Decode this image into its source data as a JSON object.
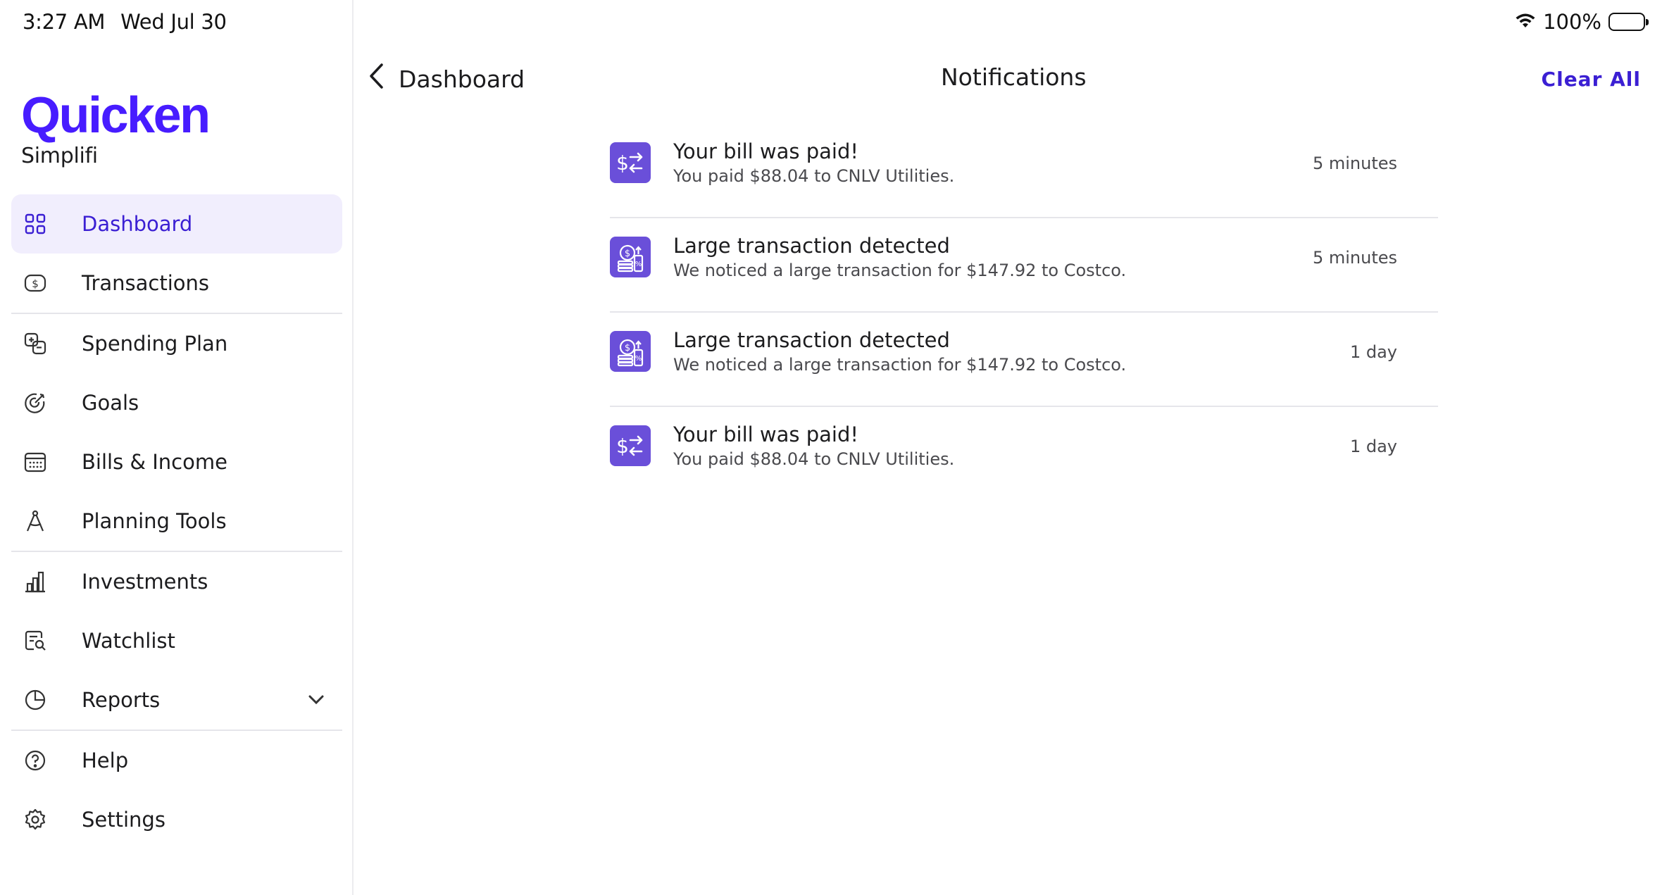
{
  "status": {
    "time": "3:27 AM",
    "date": "Wed Jul 30",
    "battery": "100%"
  },
  "brand": {
    "name": "Quicken",
    "sub": "Simplifi"
  },
  "nav": {
    "dashboard": "Dashboard",
    "transactions": "Transactions",
    "spending_plan": "Spending Plan",
    "goals": "Goals",
    "bills_income": "Bills & Income",
    "planning_tools": "Planning Tools",
    "investments": "Investments",
    "watchlist": "Watchlist",
    "reports": "Reports",
    "help": "Help",
    "settings": "Settings"
  },
  "header": {
    "back_label": "Dashboard",
    "title": "Notifications",
    "clear_all": "Clear All"
  },
  "notifications": [
    {
      "icon": "transfer-icon",
      "title": "Your bill was paid!",
      "body": "You paid $88.04 to CNLV Utilities.",
      "time": "5 minutes"
    },
    {
      "icon": "large-transaction-icon",
      "title": "Large transaction detected",
      "body": "We noticed a large transaction for $147.92 to Costco.",
      "time": "5 minutes"
    },
    {
      "icon": "large-transaction-icon",
      "title": "Large transaction detected",
      "body": "We noticed a large transaction for $147.92 to Costco.",
      "time": "1 day"
    },
    {
      "icon": "transfer-icon",
      "title": "Your bill was paid!",
      "body": "You paid $88.04 to CNLV Utilities.",
      "time": "1 day"
    }
  ],
  "colors": {
    "accent": "#471cff",
    "active_text": "#3b1fd3",
    "active_bg": "#f1eefd",
    "icon_bg": "#6a4fd9"
  }
}
